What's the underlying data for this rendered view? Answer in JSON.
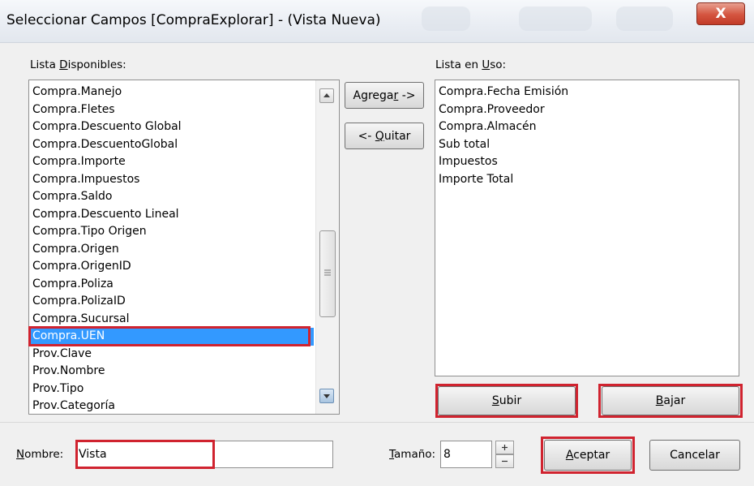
{
  "window": {
    "title": "Seleccionar Campos [CompraExplorar] - (Vista Nueva)",
    "close_label": "X"
  },
  "available": {
    "label_pre": "Lista ",
    "label_key": "D",
    "label_post": "isponibles:",
    "items": [
      "Compra.Manejo",
      "Compra.Fletes",
      "Compra.Descuento Global",
      "Compra.DescuentoGlobal",
      "Compra.Importe",
      "Compra.Impuestos",
      "Compra.Saldo",
      "Compra.Descuento Lineal",
      "Compra.Tipo Origen",
      "Compra.Origen",
      "Compra.OrigenID",
      "Compra.Poliza",
      "Compra.PolizaID",
      "Compra.Sucursal",
      "Compra.UEN",
      "Prov.Clave",
      "Prov.Nombre",
      "Prov.Tipo",
      "Prov.Categoría"
    ],
    "selected": "Compra.UEN"
  },
  "in_use": {
    "label_pre": "Lista en ",
    "label_key": "U",
    "label_post": "so:",
    "items": [
      "Compra.Fecha Emisión",
      "Compra.Proveedor",
      "Compra.Almacén",
      "Sub total",
      "Impuestos",
      "Importe Total"
    ]
  },
  "buttons": {
    "add_pre": "Agrega",
    "add_key": "r",
    "add_post": " ->",
    "remove_pre": "<- ",
    "remove_key": "Q",
    "remove_post": "uitar",
    "up_key": "S",
    "up_post": "ubir",
    "down_key": "B",
    "down_post": "ajar",
    "accept_key": "A",
    "accept_post": "ceptar",
    "cancel": "Cancelar"
  },
  "name_field": {
    "label_key": "N",
    "label_post": "ombre:",
    "value": "Vista"
  },
  "size_field": {
    "label_key": "T",
    "label_post": "amaño:",
    "value": "8"
  }
}
